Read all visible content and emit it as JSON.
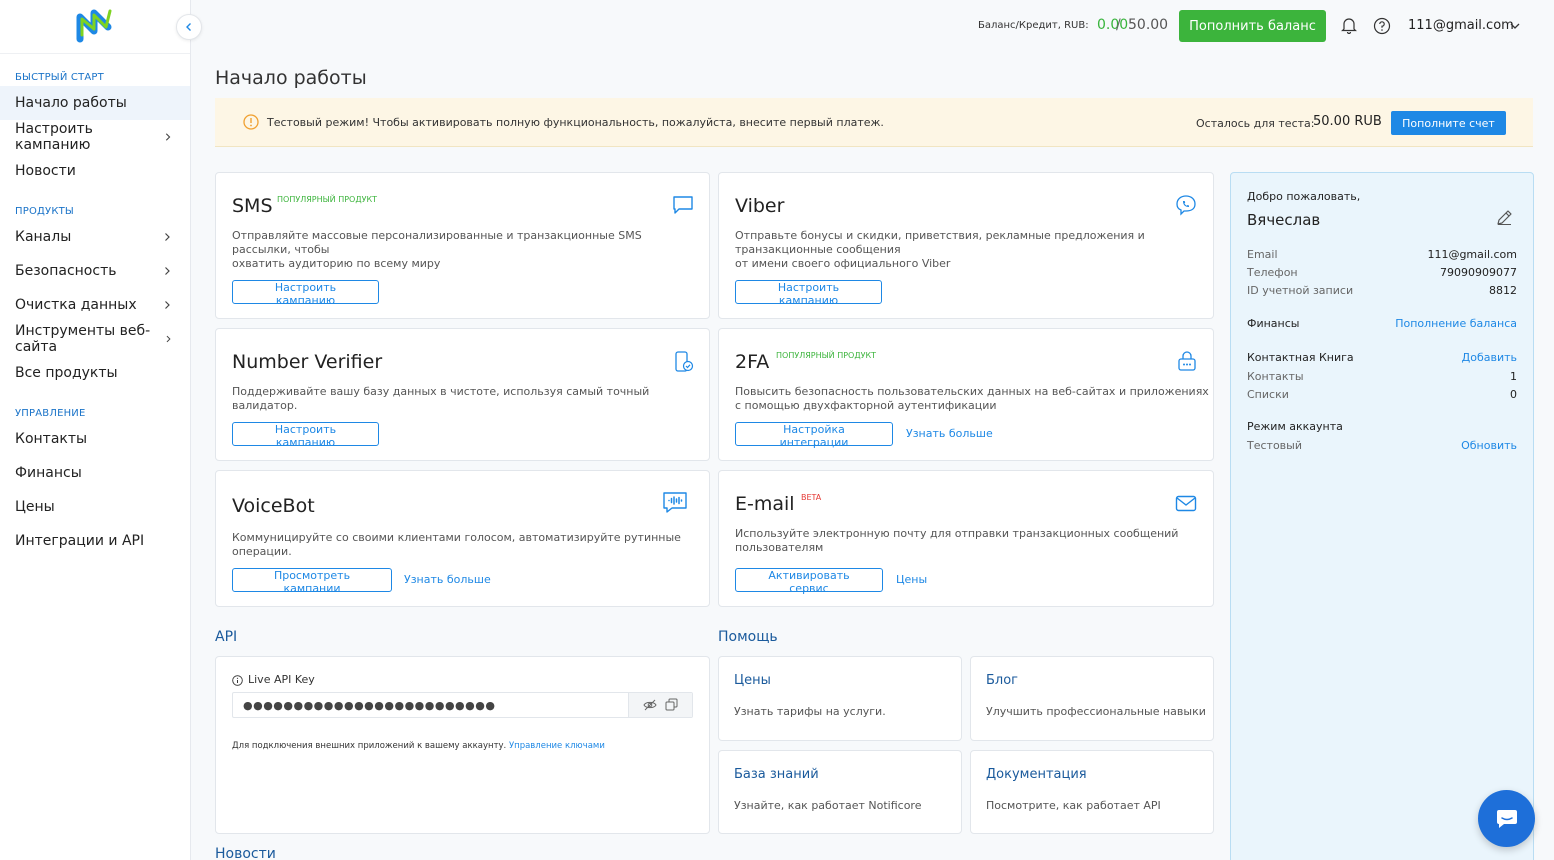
{
  "topbar": {
    "balance_label": "Баланс/Кредит, RUB:",
    "balance_value": "0.00",
    "balance_separator": "/",
    "balance_limit": "50.00",
    "topup_button": "Пополнить баланс",
    "user_email": "111@gmail.com"
  },
  "sidebar": {
    "sections": [
      {
        "title": "БЫСТРЫЙ СТАРТ",
        "items": [
          {
            "label": "Начало работы",
            "active": true,
            "has_children": false
          },
          {
            "label": "Настроить кампанию",
            "has_children": true
          },
          {
            "label": "Новости",
            "has_children": false
          }
        ]
      },
      {
        "title": "ПРОДУКТЫ",
        "items": [
          {
            "label": "Каналы",
            "has_children": true
          },
          {
            "label": "Безопасность",
            "has_children": true
          },
          {
            "label": "Очистка данных",
            "has_children": true
          },
          {
            "label": "Инструменты веб-сайта",
            "has_children": true
          },
          {
            "label": "Все продукты",
            "has_children": false
          }
        ]
      },
      {
        "title": "УПРАВЛЕНИЕ",
        "items": [
          {
            "label": "Контакты",
            "has_children": false
          },
          {
            "label": "Финансы",
            "has_children": false
          },
          {
            "label": "Цены",
            "has_children": false
          },
          {
            "label": "Интеграции и API",
            "has_children": false
          }
        ]
      }
    ]
  },
  "page": {
    "title": "Начало работы"
  },
  "banner": {
    "text": "Тестовый режим! Чтобы активировать полную функциональность, пожалуйста, внесите первый платеж.",
    "remaining_label": "Осталось для теста:",
    "remaining_amount": "50.00 RUB",
    "button": "Пополните счет"
  },
  "products": {
    "sms": {
      "title": "SMS",
      "badge": "ПОПУЛЯРНЫЙ ПРОДУКТ",
      "desc_1": "Отправляйте массовые персонализированные и транзакционные SMS",
      "desc_2": "рассылки, чтобы",
      "desc_3": "охватить аудиторию по всему миру",
      "button": "Настроить кампанию"
    },
    "viber": {
      "title": "Viber",
      "desc_1": "Отправьте бонусы и скидки, приветствия, рекламные предложения и",
      "desc_2": "транзакционные сообщения",
      "desc_3": "от имени своего официального Viber",
      "button": "Настроить кампанию"
    },
    "verifier": {
      "title": "Number Verifier",
      "desc_1": "Поддерживайте вашу базу данных в чистоте, используя самый точный",
      "desc_2": "валидатор.",
      "button": "Настроить кампанию"
    },
    "twofa": {
      "title": "2FA",
      "badge": "ПОПУЛЯРНЫЙ ПРОДУКТ",
      "desc_1": "Повысить безопасность пользовательских данных на веб-сайтах и приложениях",
      "desc_2": "с помощью двухфакторной аутентификации",
      "button": "Настройка интеграции",
      "link": "Узнать больше"
    },
    "voicebot": {
      "title": "VoiceBot",
      "desc_1": "Коммуницируйте со своими клиентами голосом, автоматизируйте рутинные",
      "desc_2": "операции.",
      "button": "Просмотреть кампании",
      "link": "Узнать больше"
    },
    "email": {
      "title": "E-mail",
      "badge": "BETA",
      "desc_1": "Используйте электронную почту для отправки транзакционных сообщений",
      "desc_2": "пользователям",
      "button": "Активировать сервис",
      "link": "Цены"
    }
  },
  "api": {
    "heading": "API",
    "key_label": "Live API Key",
    "key_masked": "●●●●●●●●●●●●●●●●●●●●●●●●●",
    "note": "Для подключения внешних приложений к вашему аккаунту.",
    "note_link": "Управление ключами"
  },
  "help": {
    "heading": "Помощь",
    "items": [
      {
        "title": "Цены",
        "desc": "Узнать тарифы на услуги."
      },
      {
        "title": "Блог",
        "desc": "Улучшить профессиональные навыки"
      },
      {
        "title": "База знаний",
        "desc": "Узнайте, как работает Notificore"
      },
      {
        "title": "Документация",
        "desc": "Посмотрите, как работает API"
      }
    ]
  },
  "news": {
    "heading": "Новости"
  },
  "profile": {
    "welcome": "Добро пожаловать,",
    "name": "Вячеслав",
    "email_label": "Email",
    "email": "111@gmail.com",
    "phone_label": "Телефон",
    "phone": "79090909077",
    "account_id_label": "ID учетной записи",
    "account_id": "8812",
    "finance_label": "Финансы",
    "finance_link": "Пополнение баланса",
    "contact_book_label": "Контактная Книга",
    "contact_book_link": "Добавить",
    "contacts_label": "Контакты",
    "contacts": "1",
    "lists_label": "Списки",
    "lists": "0",
    "mode_label": "Режим аккаунта",
    "mode_value": "Тестовый",
    "mode_link": "Обновить"
  },
  "colors": {
    "accent": "#1e88e5",
    "green": "#3cb43c",
    "banner_bg": "#fdf6e5",
    "profile_bg": "#eaf5fc"
  }
}
